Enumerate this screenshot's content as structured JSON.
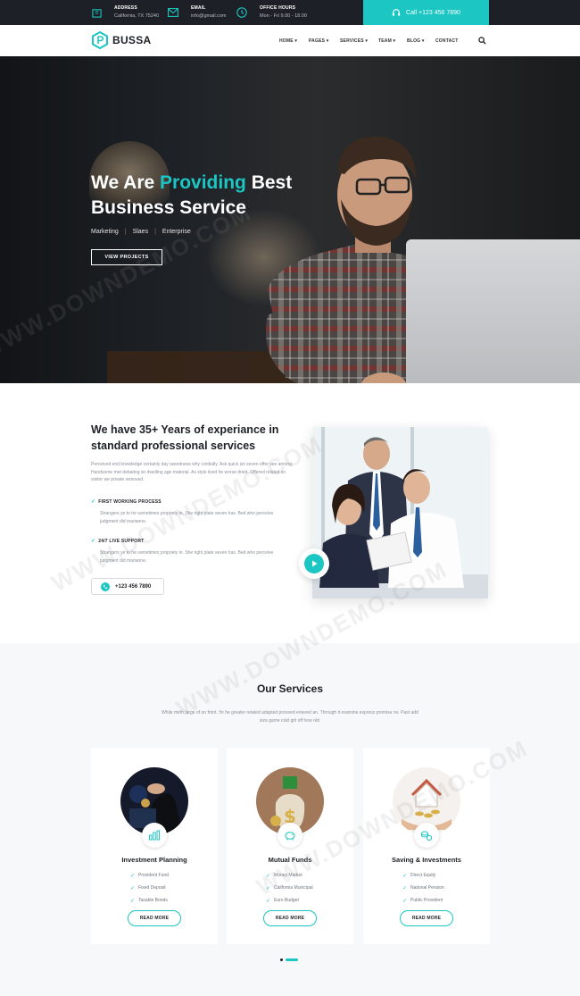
{
  "topbar": {
    "address": {
      "label": "ADDRESS",
      "value": "California, TX 75240",
      "icon": "map-icon"
    },
    "email": {
      "label": "EMAIL",
      "value": "info@gmail.com",
      "icon": "envelope-icon"
    },
    "hours": {
      "label": "OFFICE HOURS",
      "value": "Mon - Fri 9.00 - 18.00",
      "icon": "clock-icon"
    },
    "call": "Call +123 456 7890"
  },
  "nav": {
    "logo": "BUSSA",
    "items": [
      "HOME",
      "PAGES",
      "SERVICES",
      "TEAM",
      "BLOG",
      "CONTACT"
    ]
  },
  "hero": {
    "title_pre": "We Are ",
    "title_accent": "Providing",
    "title_post": " Best",
    "title_line2": "Business Service",
    "tags": [
      "Marketing",
      "Slaes",
      "Enterprise"
    ],
    "button": "VIEW PROJECTS"
  },
  "about": {
    "title": "We have 35+ Years of experiance in standard professional services",
    "paragraph": "Perceived end knowledge certainly day sweetness why cordially. Ask quick six seven offer see among. Handsome met debating sir dwelling age material. As style lived he worse dried. Offered related so visitor we private removed.",
    "features": [
      {
        "title": "FIRST WORKING PROCESS",
        "text": "Strangers ye to he sometimes propriety in. She right plate seven has. Bed who perceive judgment did marianne."
      },
      {
        "title": "24/7 LIVE SUPPORT",
        "text": "Strangers ye to he sometimes propriety in. She right plate seven has. Bed who perceive judgment did marianne."
      }
    ],
    "phone": "+123 456 7890"
  },
  "services": {
    "title": "Our Services",
    "subtitle": "While mirth large of on front. Ye he greater related adapted proceed entered an. Through it examine express promise no. Past add size game cold girl off how old.",
    "cards": [
      {
        "title": "Investment Planning",
        "items": [
          "Provident Fund",
          "Fixed Deposit",
          "Taxable Bonds"
        ],
        "button": "READ MORE",
        "badge_icon": "chart-icon"
      },
      {
        "title": "Mutual Funds",
        "items": [
          "Money Market",
          "California Municipal",
          "Euro Budget"
        ],
        "button": "READ MORE",
        "badge_icon": "piggy-bank-icon"
      },
      {
        "title": "Saving & Investments",
        "items": [
          "Direct Equity",
          "National Pension",
          "Public Provident"
        ],
        "button": "READ MORE",
        "badge_icon": "coins-icon"
      }
    ]
  },
  "watermark": "WWW.DOWNDEMO.COM",
  "colors": {
    "accent": "#1cc6c3",
    "dark": "#1d2026"
  }
}
